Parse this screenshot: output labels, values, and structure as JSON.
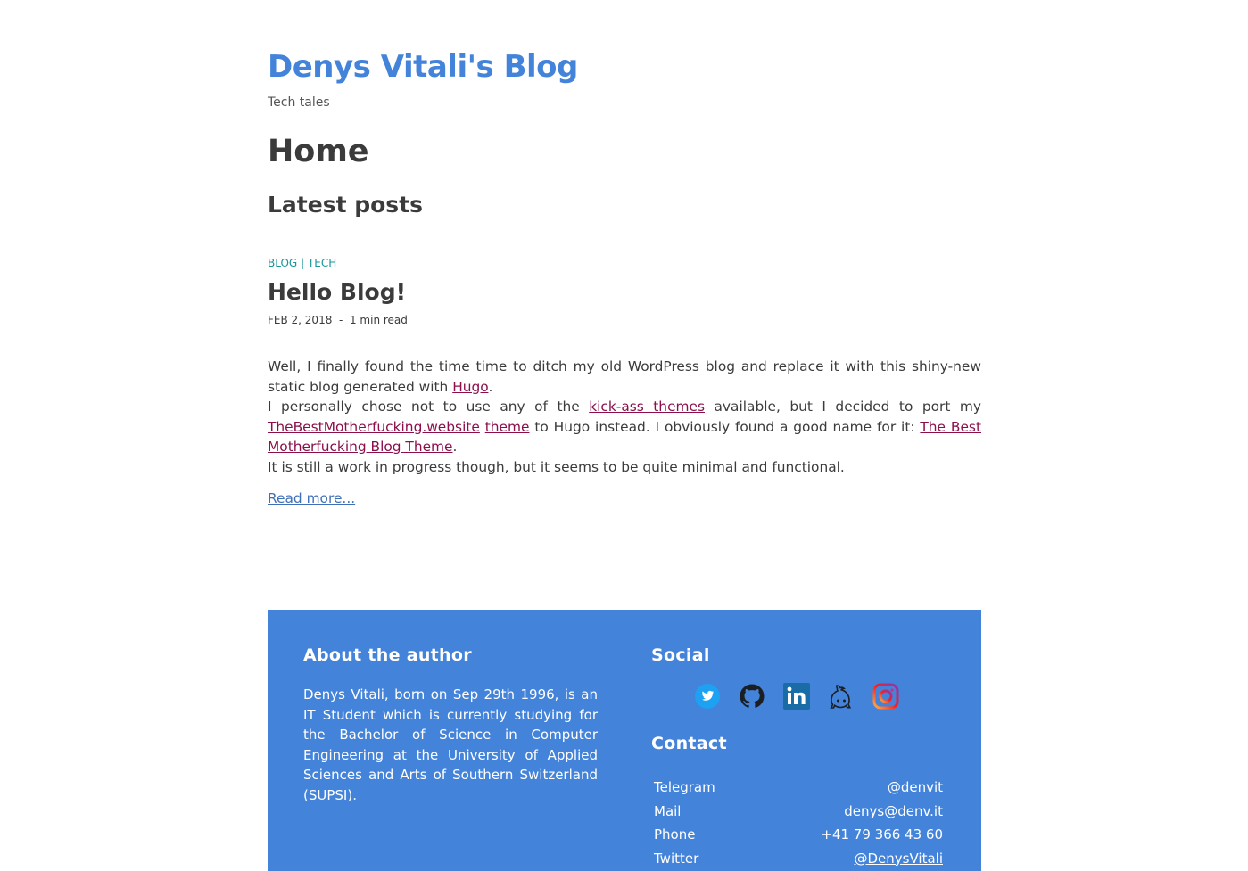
{
  "header": {
    "site_title": "Denys Vitali's Blog",
    "tagline": "Tech tales"
  },
  "page": {
    "title": "Home",
    "section_title": "Latest posts"
  },
  "post": {
    "categories": [
      "BLOG",
      "TECH"
    ],
    "category_separator": "|",
    "title": "Hello Blog!",
    "date": "FEB 2, 2018",
    "meta_separator": "-",
    "read_time": "1 min read",
    "p1_before": "Well, I finally found the time time to ditch my old WordPress blog and replace it with this shiny-new static blog generated with ",
    "p1_link": "Hugo",
    "p1_after": ".",
    "p2_before": "I personally chose not to use any of the ",
    "p2_link1": "kick-ass themes",
    "p2_mid1": " available, but I decided to port my ",
    "p2_link2": "TheBestMotherfucking.website",
    "p2_mid2": " ",
    "p2_link3": "theme",
    "p2_mid3": " to Hugo instead. I obviously found a good name for it: ",
    "p2_link4": "The Best Motherfucking Blog Theme",
    "p2_after": ".",
    "p3": "It is still a work in progress though, but it seems to be quite minimal and functional.",
    "read_more": "Read more..."
  },
  "footer": {
    "about_title": "About the author",
    "about_text_before": "Denys Vitali, born on Sep 29th 1996, is an IT Student which is currently studying for the Bachelor of Science in Computer Engineering at the University of Applied Sciences and Arts of Southern Switzerland (",
    "about_link": "SUPSI",
    "about_text_after": ").",
    "social_title": "Social",
    "social_icons": [
      "twitter-icon",
      "github-icon",
      "linkedin-icon",
      "keybase-icon",
      "instagram-icon"
    ],
    "contact_title": "Contact",
    "contacts": [
      {
        "label": "Telegram",
        "value": "@denvit"
      },
      {
        "label": "Mail",
        "value": "denys@denv.it"
      },
      {
        "label": "Phone",
        "value": "+41 79 366 43 60"
      },
      {
        "label": "Twitter",
        "value": "@DenysVitali"
      }
    ]
  },
  "colors": {
    "accent": "#4383d9",
    "category": "#18969a",
    "link": "#8c0f4b",
    "read_more": "#3f70b6",
    "text": "#3b3b3b"
  }
}
